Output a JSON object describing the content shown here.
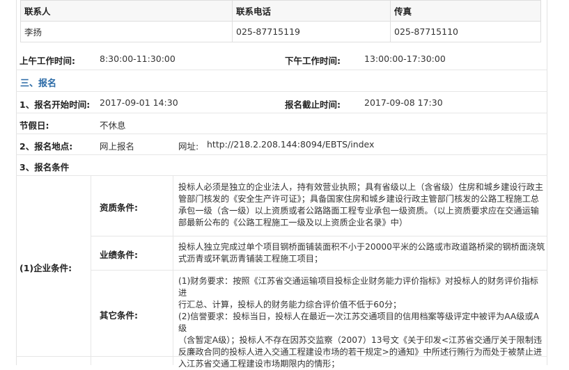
{
  "contact_table": {
    "headers": [
      "联系人",
      "联系电话",
      "传真"
    ],
    "row": [
      "李扬",
      "025-87715119",
      "025-87715110"
    ]
  },
  "work_hours": {
    "am_label": "上午工作时间:",
    "am_value": "8:30:00-11:30:00",
    "pm_label": "下午工作时间:",
    "pm_value": "13:00:00-17:30:00"
  },
  "section_title": "三、报名",
  "signup": {
    "start_label": "1、报名开始时间:",
    "start_value": "2017-09-01 14:30",
    "end_label": "报名截止时间:",
    "end_value": "2017-09-08 17:30",
    "holiday_label": "节假日:",
    "holiday_value": "不休息",
    "place_label": "2、报名地点:",
    "place_value": "网上报名",
    "url_label": "网址:",
    "url_value": "http://218.2.208.144:8094/EBTS/index",
    "cond_label": "3、报名条件"
  },
  "enterprise": {
    "label": "(1)企业条件:",
    "items": [
      {
        "label": "资质条件:",
        "lines": [
          "投标人必须是独立的企业法人，持有效营业执照；具有省级以上（含省级）住房和城乡建设行政主",
          "管部门核发的《安全生产许可证》；具备国家住房和城乡建设行政主管部门核发的公路工程施工总",
          "承包一级（含一级）以上资质或者公路路面工程专业承包一级资质。（以上资质要求应在交通运输",
          "部最新公布的《公路工程施工一级及以上资质企业名录》中）"
        ]
      },
      {
        "label": "业绩条件:",
        "lines": [
          "投标人独立完成过单个项目钢桥面铺装面积不小于20000平米的公路或市政道路桥梁的钢桥面浇筑",
          "式沥青或环氧沥青铺装工程施工项目；"
        ]
      },
      {
        "label": "其它条件:",
        "lines": [
          "(1)财务要求：按照《江苏省交通运输项目投标企业财务能力评价指标》对投标人的财务评价指标进",
          "行汇总、计算，投标人的财务能力综合评价值不低于60分；",
          "(2)信誉要求：投标当日，投标人在最近一次江苏交通项目的信用档案等级评定中被评为AA级或A级",
          "（含暂定A级）；投标人不存在因苏交监察（2007）13号文《关于印发<江苏省交通厅关于限制违",
          "反廉政合同的投标人进入交通工程建设市场的若干规定>的通知》中所述行贿行为而处于被禁止进",
          "入江苏省交通工程建设市场期限内的情形；"
        ]
      }
    ]
  }
}
